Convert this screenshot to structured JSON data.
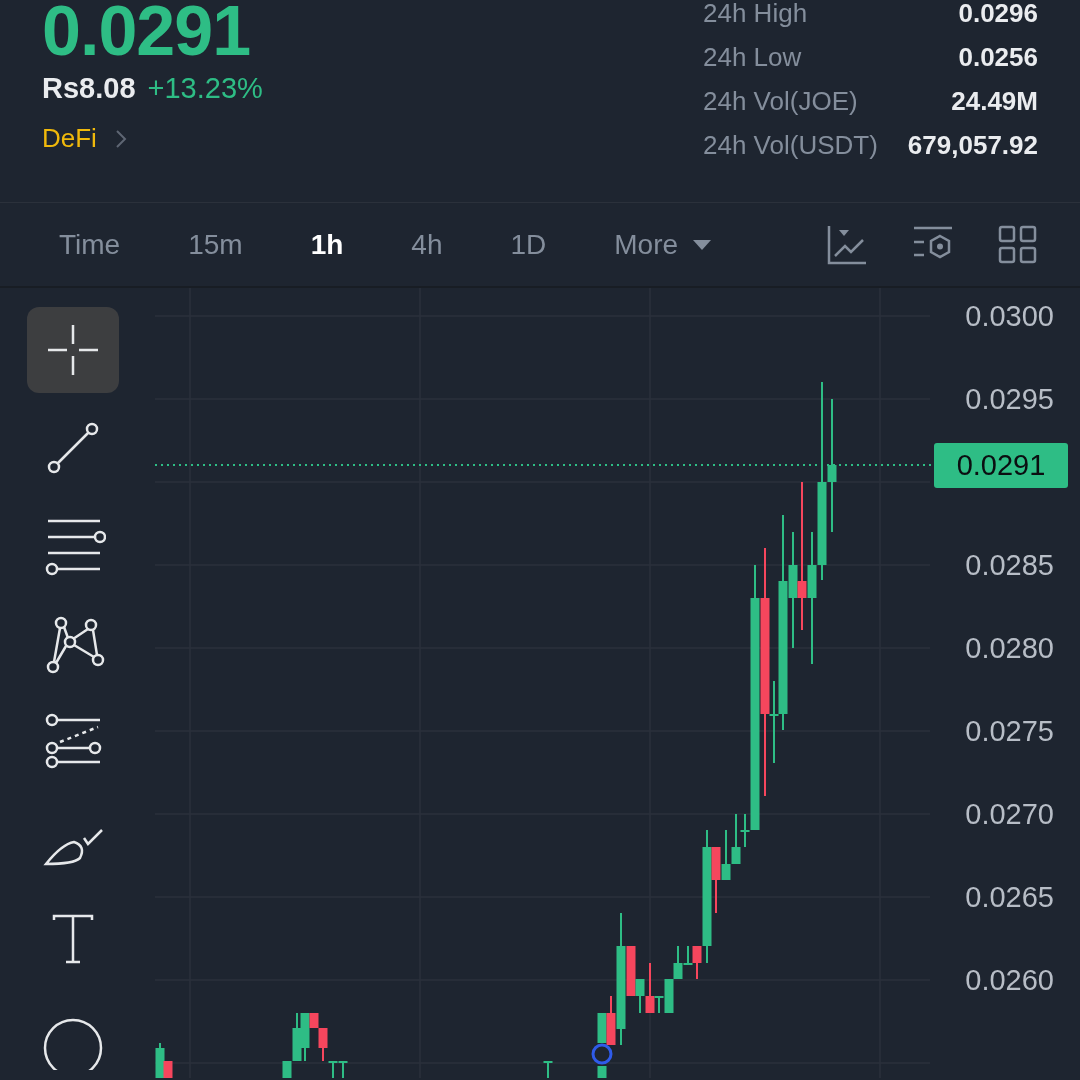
{
  "ticker": {
    "last_price": "0.0291",
    "fiat_price": "Rs8.08",
    "change": "+13.23%",
    "category": "DeFi"
  },
  "stats": [
    {
      "label": "24h High",
      "value": "0.0296"
    },
    {
      "label": "24h Low",
      "value": "0.0256"
    },
    {
      "label": "24h Vol(JOE)",
      "value": "24.49M"
    },
    {
      "label": "24h Vol(USDT)",
      "value": "679,057.92"
    }
  ],
  "intervals": [
    {
      "label": "Time",
      "selected": false,
      "kind": "plain"
    },
    {
      "label": "15m",
      "selected": false,
      "kind": "plain"
    },
    {
      "label": "1h",
      "selected": true,
      "kind": "plain"
    },
    {
      "label": "4h",
      "selected": false,
      "kind": "plain"
    },
    {
      "label": "1D",
      "selected": false,
      "kind": "plain"
    },
    {
      "label": "More",
      "selected": false,
      "kind": "dropdown"
    }
  ],
  "drawing_tools": [
    {
      "kind": "crosshair",
      "selected": true
    },
    {
      "kind": "trend-line",
      "selected": false
    },
    {
      "kind": "parallel-lines",
      "selected": false
    },
    {
      "kind": "pattern",
      "selected": false
    },
    {
      "kind": "fib-lines",
      "selected": false
    },
    {
      "kind": "brush",
      "selected": false
    },
    {
      "kind": "text",
      "selected": false
    },
    {
      "kind": "circle",
      "selected": false
    }
  ],
  "chart": {
    "price_labels": [
      "0.0300",
      "0.0295",
      "0.0285",
      "0.0280",
      "0.0275",
      "0.0270",
      "0.0265",
      "0.0260"
    ],
    "current_price": "0.0291"
  }
}
